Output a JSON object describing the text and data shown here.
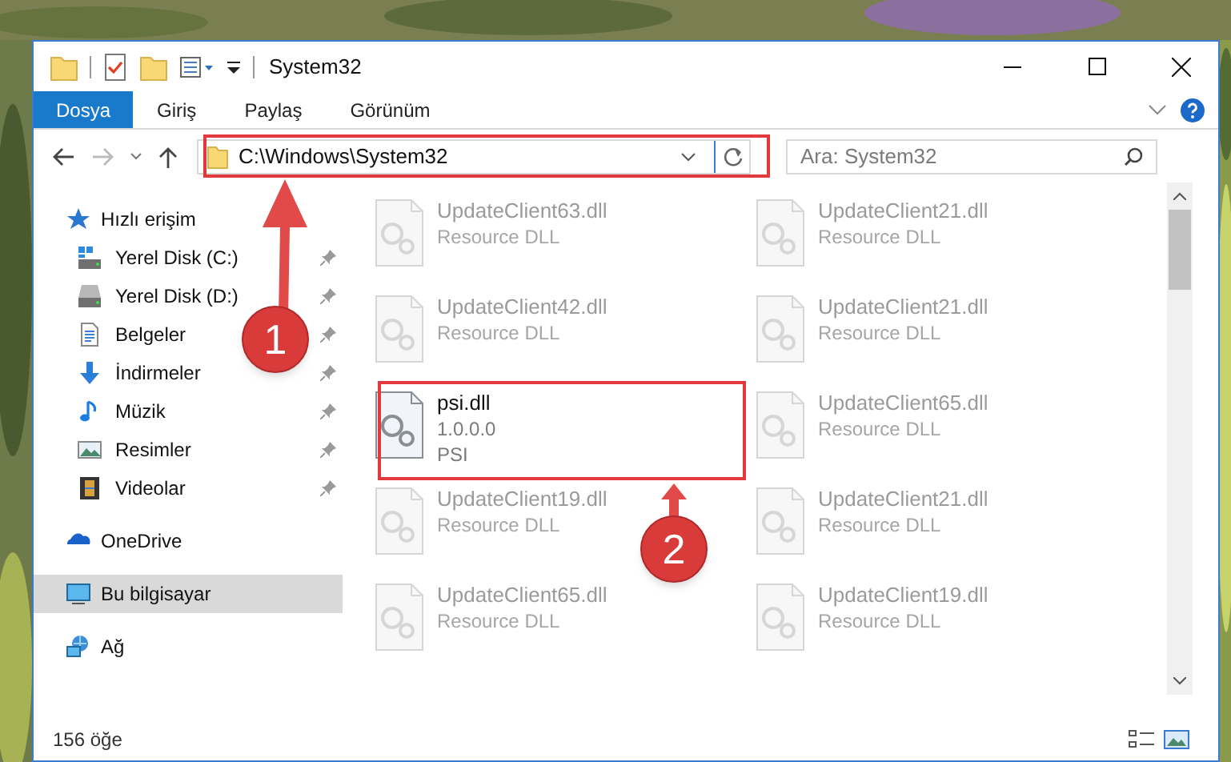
{
  "window": {
    "title": "System32"
  },
  "ribbon": {
    "tabs": [
      {
        "label": "Dosya",
        "selected": true
      },
      {
        "label": "Giriş",
        "selected": false
      },
      {
        "label": "Paylaş",
        "selected": false
      },
      {
        "label": "Görünüm",
        "selected": false
      }
    ]
  },
  "address_bar": {
    "path": "C:\\Windows\\System32"
  },
  "search": {
    "placeholder": "Ara: System32"
  },
  "sidebar": {
    "items": [
      {
        "label": "Hızlı erişim",
        "selected": false,
        "children": [
          {
            "label": "Yerel Disk (C:)",
            "pinned": true,
            "selected": false
          },
          {
            "label": "Yerel Disk (D:)",
            "pinned": true,
            "selected": false
          },
          {
            "label": "Belgeler",
            "pinned": true,
            "selected": false
          },
          {
            "label": "İndirmeler",
            "pinned": true,
            "selected": false
          },
          {
            "label": "Müzik",
            "pinned": true,
            "selected": false
          },
          {
            "label": "Resimler",
            "pinned": true,
            "selected": false
          },
          {
            "label": "Videolar",
            "pinned": true,
            "selected": false
          }
        ]
      },
      {
        "label": "OneDrive",
        "selected": false
      },
      {
        "label": "Bu bilgisayar",
        "selected": true
      },
      {
        "label": "Ağ",
        "selected": false
      }
    ]
  },
  "files": [
    {
      "name": "UpdateClient63.dll",
      "details": [
        "Resource DLL"
      ],
      "kind": "blurred"
    },
    {
      "name": "UpdateClient21.dll",
      "details": [
        "Resource DLL"
      ],
      "kind": "blurred"
    },
    {
      "name": "UpdateClient42.dll",
      "details": [
        "Resource DLL"
      ],
      "kind": "blurred"
    },
    {
      "name": "UpdateClient21.dll",
      "details": [
        "Resource DLL"
      ],
      "kind": "blurred"
    },
    {
      "name": "psi.dll",
      "details": [
        "1.0.0.0",
        "PSI"
      ],
      "kind": "normal"
    },
    {
      "name": "UpdateClient65.dll",
      "details": [
        "Resource DLL"
      ],
      "kind": "blurred"
    },
    {
      "name": "UpdateClient19.dll",
      "details": [
        "Resource DLL"
      ],
      "kind": "blurred"
    },
    {
      "name": "UpdateClient21.dll",
      "details": [
        "Resource DLL"
      ],
      "kind": "blurred"
    },
    {
      "name": "UpdateClient65.dll",
      "details": [
        "Resource DLL"
      ],
      "kind": "blurred"
    },
    {
      "name": "UpdateClient19.dll",
      "details": [
        "Resource DLL"
      ],
      "kind": "blurred"
    }
  ],
  "status_bar": {
    "item_count": "156 öğe"
  },
  "annotations": [
    {
      "number": "1"
    },
    {
      "number": "2"
    }
  ]
}
